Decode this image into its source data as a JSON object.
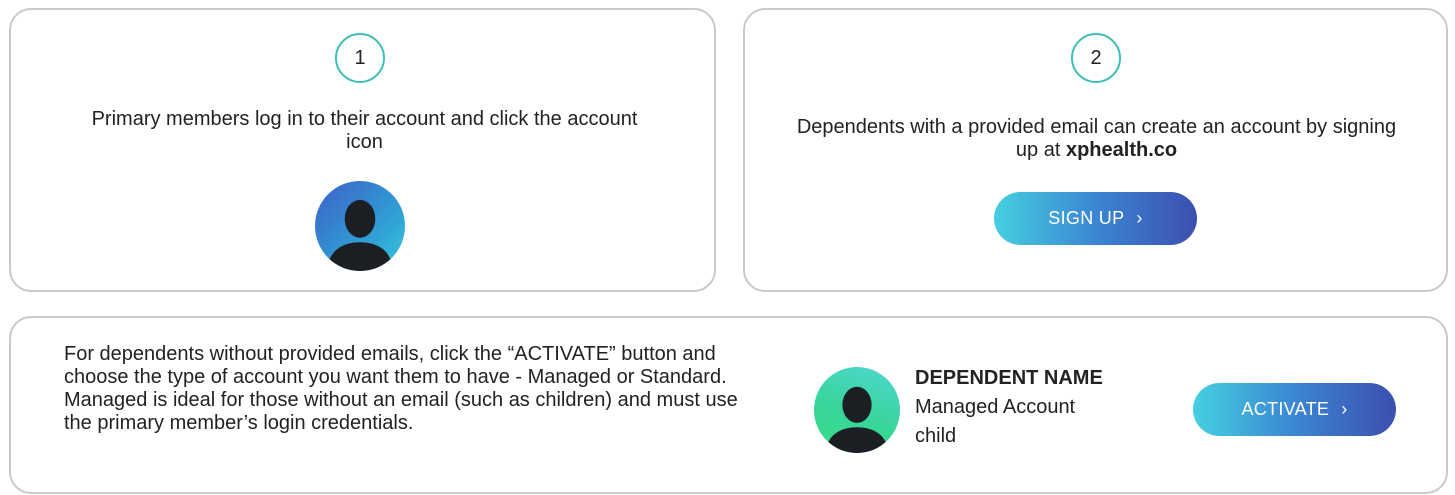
{
  "step1": {
    "number": "1",
    "text": "Primary members log in to their account and click the account icon",
    "icon": "user-avatar-icon"
  },
  "step2": {
    "number": "2",
    "text_prefix": "Dependents with a provided email can create an account by signing up at ",
    "text_link": "xphealth.co",
    "button_label": "SIGN UP",
    "button_chevron": "›"
  },
  "step3": {
    "description": "For dependents without provided emails, click the “ACTIVATE” button and choose the type of account you want them to have - Managed or Standard. Managed is ideal for those without an email (such as children) and must use the primary member’s login credentials.",
    "dependent_name": "DEPENDENT NAME",
    "account_type": "Managed Account",
    "relation": "child",
    "button_label": "ACTIVATE",
    "button_chevron": "›"
  },
  "colors": {
    "accent_teal": "#3bbfb8",
    "card_border": "#c9c9c9",
    "button_start": "#46cfe0",
    "button_end": "#3b4fb0",
    "avatar_blue": "#3b5fc8",
    "avatar_green": "#38d59a"
  }
}
